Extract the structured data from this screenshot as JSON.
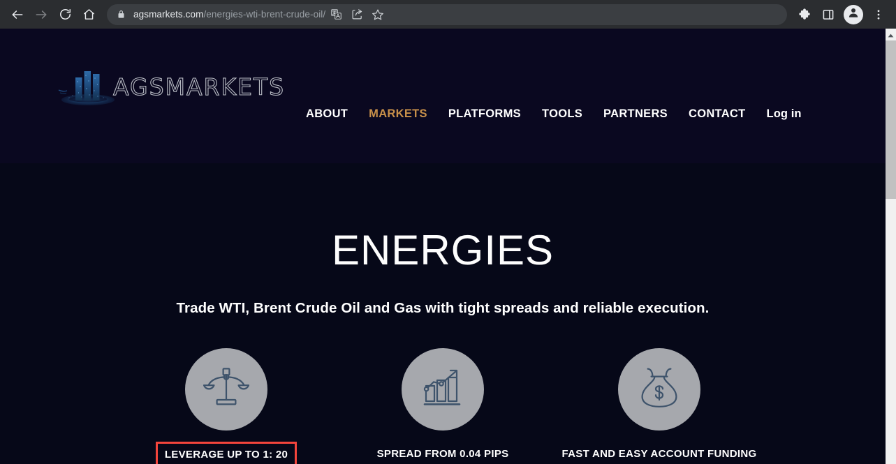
{
  "browser": {
    "back_icon": "back-arrow-icon",
    "forward_icon": "forward-arrow-icon",
    "reload_icon": "reload-icon",
    "home_icon": "home-icon",
    "lock_icon": "lock-icon",
    "url_domain": "agsmarkets.com",
    "url_path": "/energies-wti-brent-crude-oil/",
    "url_full": "agsmarkets.com/energies-wti-brent-crude-oil/",
    "translate_icon": "translate-icon",
    "share_icon": "share-icon",
    "bookmark_icon": "bookmark-star-icon",
    "extensions_icon": "extensions-puzzle-icon",
    "sidepanel_icon": "side-panel-icon",
    "profile_icon": "profile-avatar-icon",
    "menu_icon": "three-dot-menu-icon"
  },
  "site": {
    "logo_text": "AGSMARKETS",
    "nav": [
      {
        "label": "ABOUT",
        "active": false
      },
      {
        "label": "MARKETS",
        "active": true
      },
      {
        "label": "PLATFORMS",
        "active": false
      },
      {
        "label": "TOOLS",
        "active": false
      },
      {
        "label": "PARTNERS",
        "active": false
      },
      {
        "label": "CONTACT",
        "active": false
      },
      {
        "label": "Log in",
        "active": false
      }
    ]
  },
  "hero": {
    "title": "ENERGIES",
    "subtitle": "Trade WTI, Brent Crude Oil and Gas with tight spreads and reliable execution."
  },
  "features": [
    {
      "icon": "balance-scale-icon",
      "label": "LEVERAGE UP TO 1: 20",
      "highlighted": true
    },
    {
      "icon": "bar-chart-growth-icon",
      "label": "SPREAD FROM 0.04 PIPS",
      "highlighted": false
    },
    {
      "icon": "money-bag-icon",
      "label": "FAST AND EASY ACCOUNT FUNDING",
      "highlighted": false
    }
  ],
  "colors": {
    "accent_gold": "#c8904a",
    "highlight_red": "#f4453c",
    "header_bg": "#0a0820",
    "page_bg": "#060818",
    "icon_circle": "#a6a8ad",
    "icon_stroke": "#3e536b"
  },
  "scrollbar": {
    "up_arrow_icon": "scroll-up-arrow-icon"
  }
}
